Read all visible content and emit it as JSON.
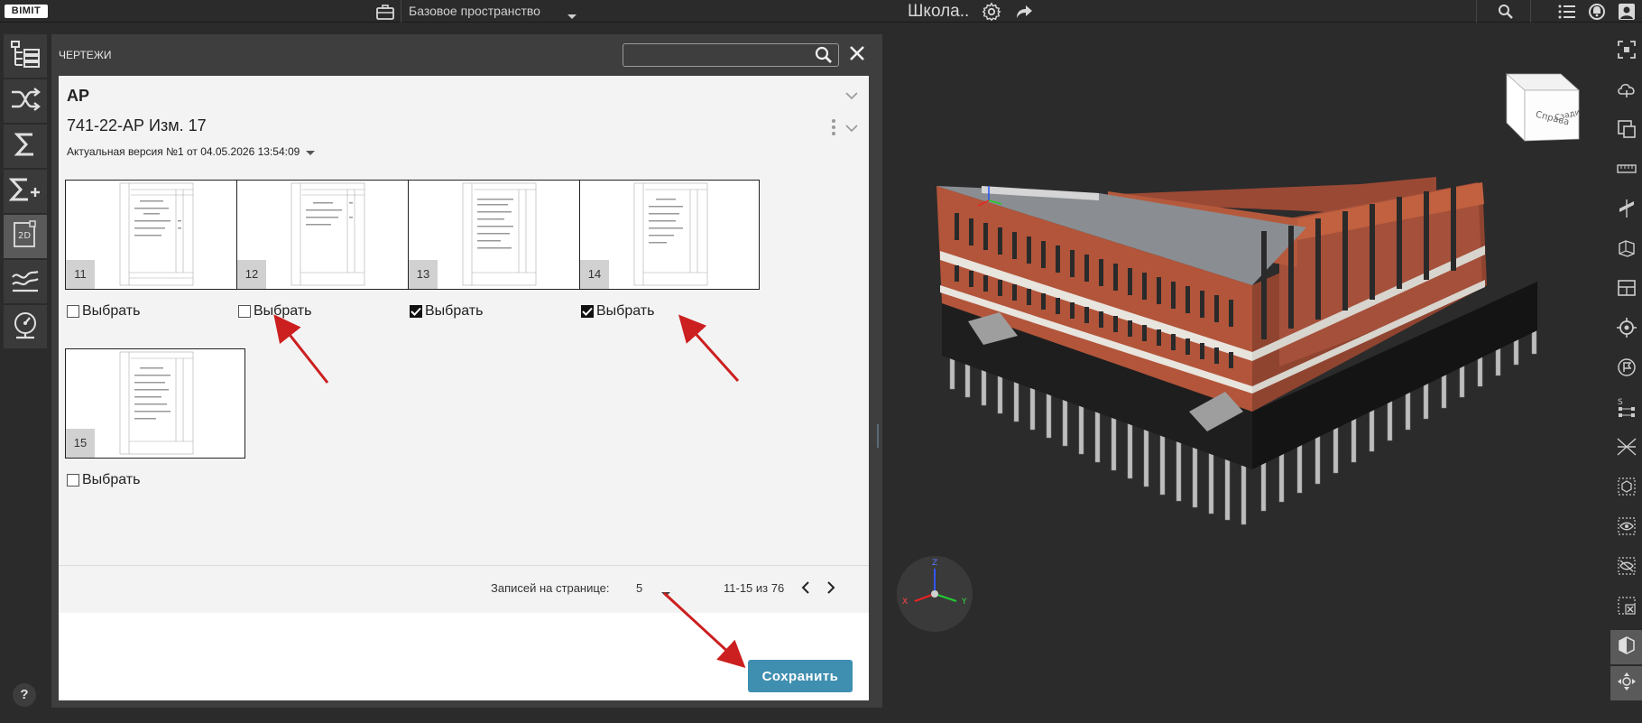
{
  "topbar": {
    "logo": "BIMIT",
    "workspace": "Базовое пространство",
    "project_title": "Школа.."
  },
  "panel": {
    "title": "ЧЕРТЕЖИ",
    "search_placeholder": "",
    "section_title": "АР",
    "document_title": "741-22-АР Изм. 17",
    "version_text": "Актуальная версия №1 от 04.05.2026 13:54:09",
    "select_label": "Выбрать",
    "cards": [
      {
        "number": "11",
        "checked": false
      },
      {
        "number": "12",
        "checked": false
      },
      {
        "number": "13",
        "checked": true
      },
      {
        "number": "14",
        "checked": true
      },
      {
        "number": "15",
        "checked": false
      }
    ],
    "pagination": {
      "label": "Записей на странице:",
      "page_size": "5",
      "range": "11-15 из 76"
    },
    "save_label": "Сохранить"
  },
  "viewcube": {
    "front": "Справа",
    "side": "Сзади"
  },
  "axes": {
    "x": "X",
    "y": "Y",
    "z": "Z"
  },
  "help_label": "?",
  "colors": {
    "accent": "#3f8fb0",
    "brick": "#b2553a",
    "annotation_arrow": "#cc1f1f",
    "background": "#2b2b2b"
  }
}
